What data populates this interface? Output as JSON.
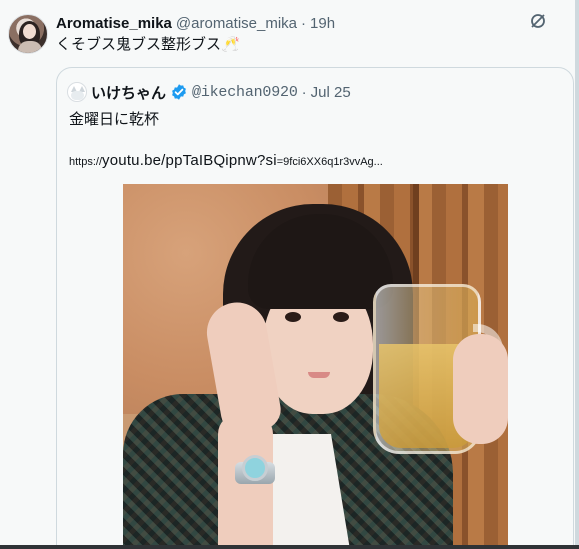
{
  "tweet": {
    "display_name": "Aromatise_mika",
    "handle": "@aromatise_mika",
    "separator": "·",
    "time": "19h",
    "text": "くそブス鬼ブス整形ブス🥂"
  },
  "quoted_tweet": {
    "display_name": "いけちゃん",
    "handle": "@ikechan0920",
    "separator": "·",
    "date": "Jul 25",
    "text": "金曜日に乾杯",
    "link_prefix": "https://",
    "link_main": "youtu.be/ppTaIBQipnw?si",
    "link_suffix": "=9fci6XX6q1r3vvAg..."
  },
  "icons": {
    "more": "grok-icon",
    "verified": "verified-badge-icon",
    "verified_color": "#1d9bf0"
  }
}
